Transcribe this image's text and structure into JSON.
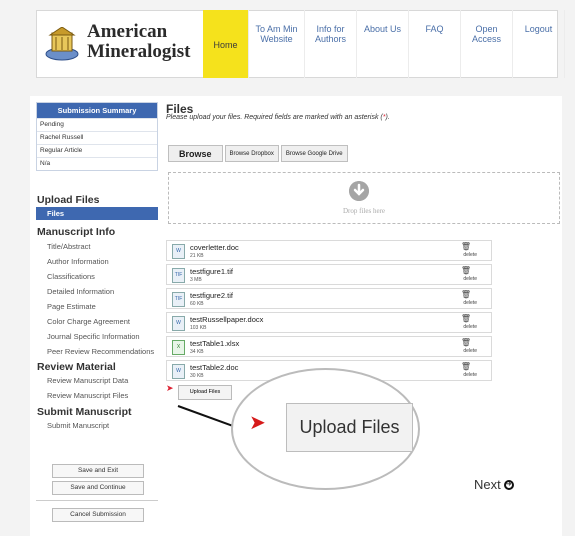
{
  "header": {
    "brand_line1": "American",
    "brand_line2": "Mineralogist",
    "nav": [
      "Home",
      "To Am Min Website",
      "Info for Authors",
      "About Us",
      "FAQ",
      "Open Access",
      "Logout"
    ]
  },
  "summary": {
    "title": "Submission Summary",
    "rows": [
      "Pending",
      "Rachel Russell",
      "Regular Article",
      "N/a"
    ]
  },
  "sidebar": {
    "upload_files": "Upload Files",
    "files": "Files",
    "manuscript_info": "Manuscript Info",
    "manuscript_items": [
      "Title/Abstract",
      "Author Information",
      "Classifications",
      "Detailed Information",
      "Page Estimate",
      "Color Charge Agreement",
      "Journal Specific Information",
      "Peer Review Recommendations"
    ],
    "review_material": "Review Material",
    "review_items": [
      "Review Manuscript Data",
      "Review Manuscript Files"
    ],
    "submit_manuscript": "Submit Manuscript",
    "submit_items": [
      "Submit Manuscript"
    ],
    "save_exit": "Save and Exit",
    "save_continue": "Save and Continue",
    "cancel": "Cancel Submission"
  },
  "main": {
    "title": "Files",
    "instructions": "Please upload your files. Required fields are marked with an asterisk (",
    "instructions_star": "*",
    "instructions_end": ").",
    "browse": "Browse",
    "browse_dropbox": "Browse Dropbox",
    "browse_gdrive": "Browse Google Drive",
    "drop_label": "Drop files here",
    "delete_label": "delete",
    "files": [
      {
        "name": "coverletter.doc",
        "size": "21 KB",
        "type": "doc"
      },
      {
        "name": "testfigure1.tif",
        "size": "3 MB",
        "type": "tif"
      },
      {
        "name": "testfigure2.tif",
        "size": "60 KB",
        "type": "tif"
      },
      {
        "name": "testRussellpaper.docx",
        "size": "103 KB",
        "type": "docx"
      },
      {
        "name": "testTable1.xlsx",
        "size": "34 KB",
        "type": "xlsx"
      },
      {
        "name": "testTable2.doc",
        "size": "30 KB",
        "type": "doc"
      }
    ],
    "upload_small": "Upload Files",
    "upload_zoom": "Upload Files",
    "next": "Next"
  }
}
